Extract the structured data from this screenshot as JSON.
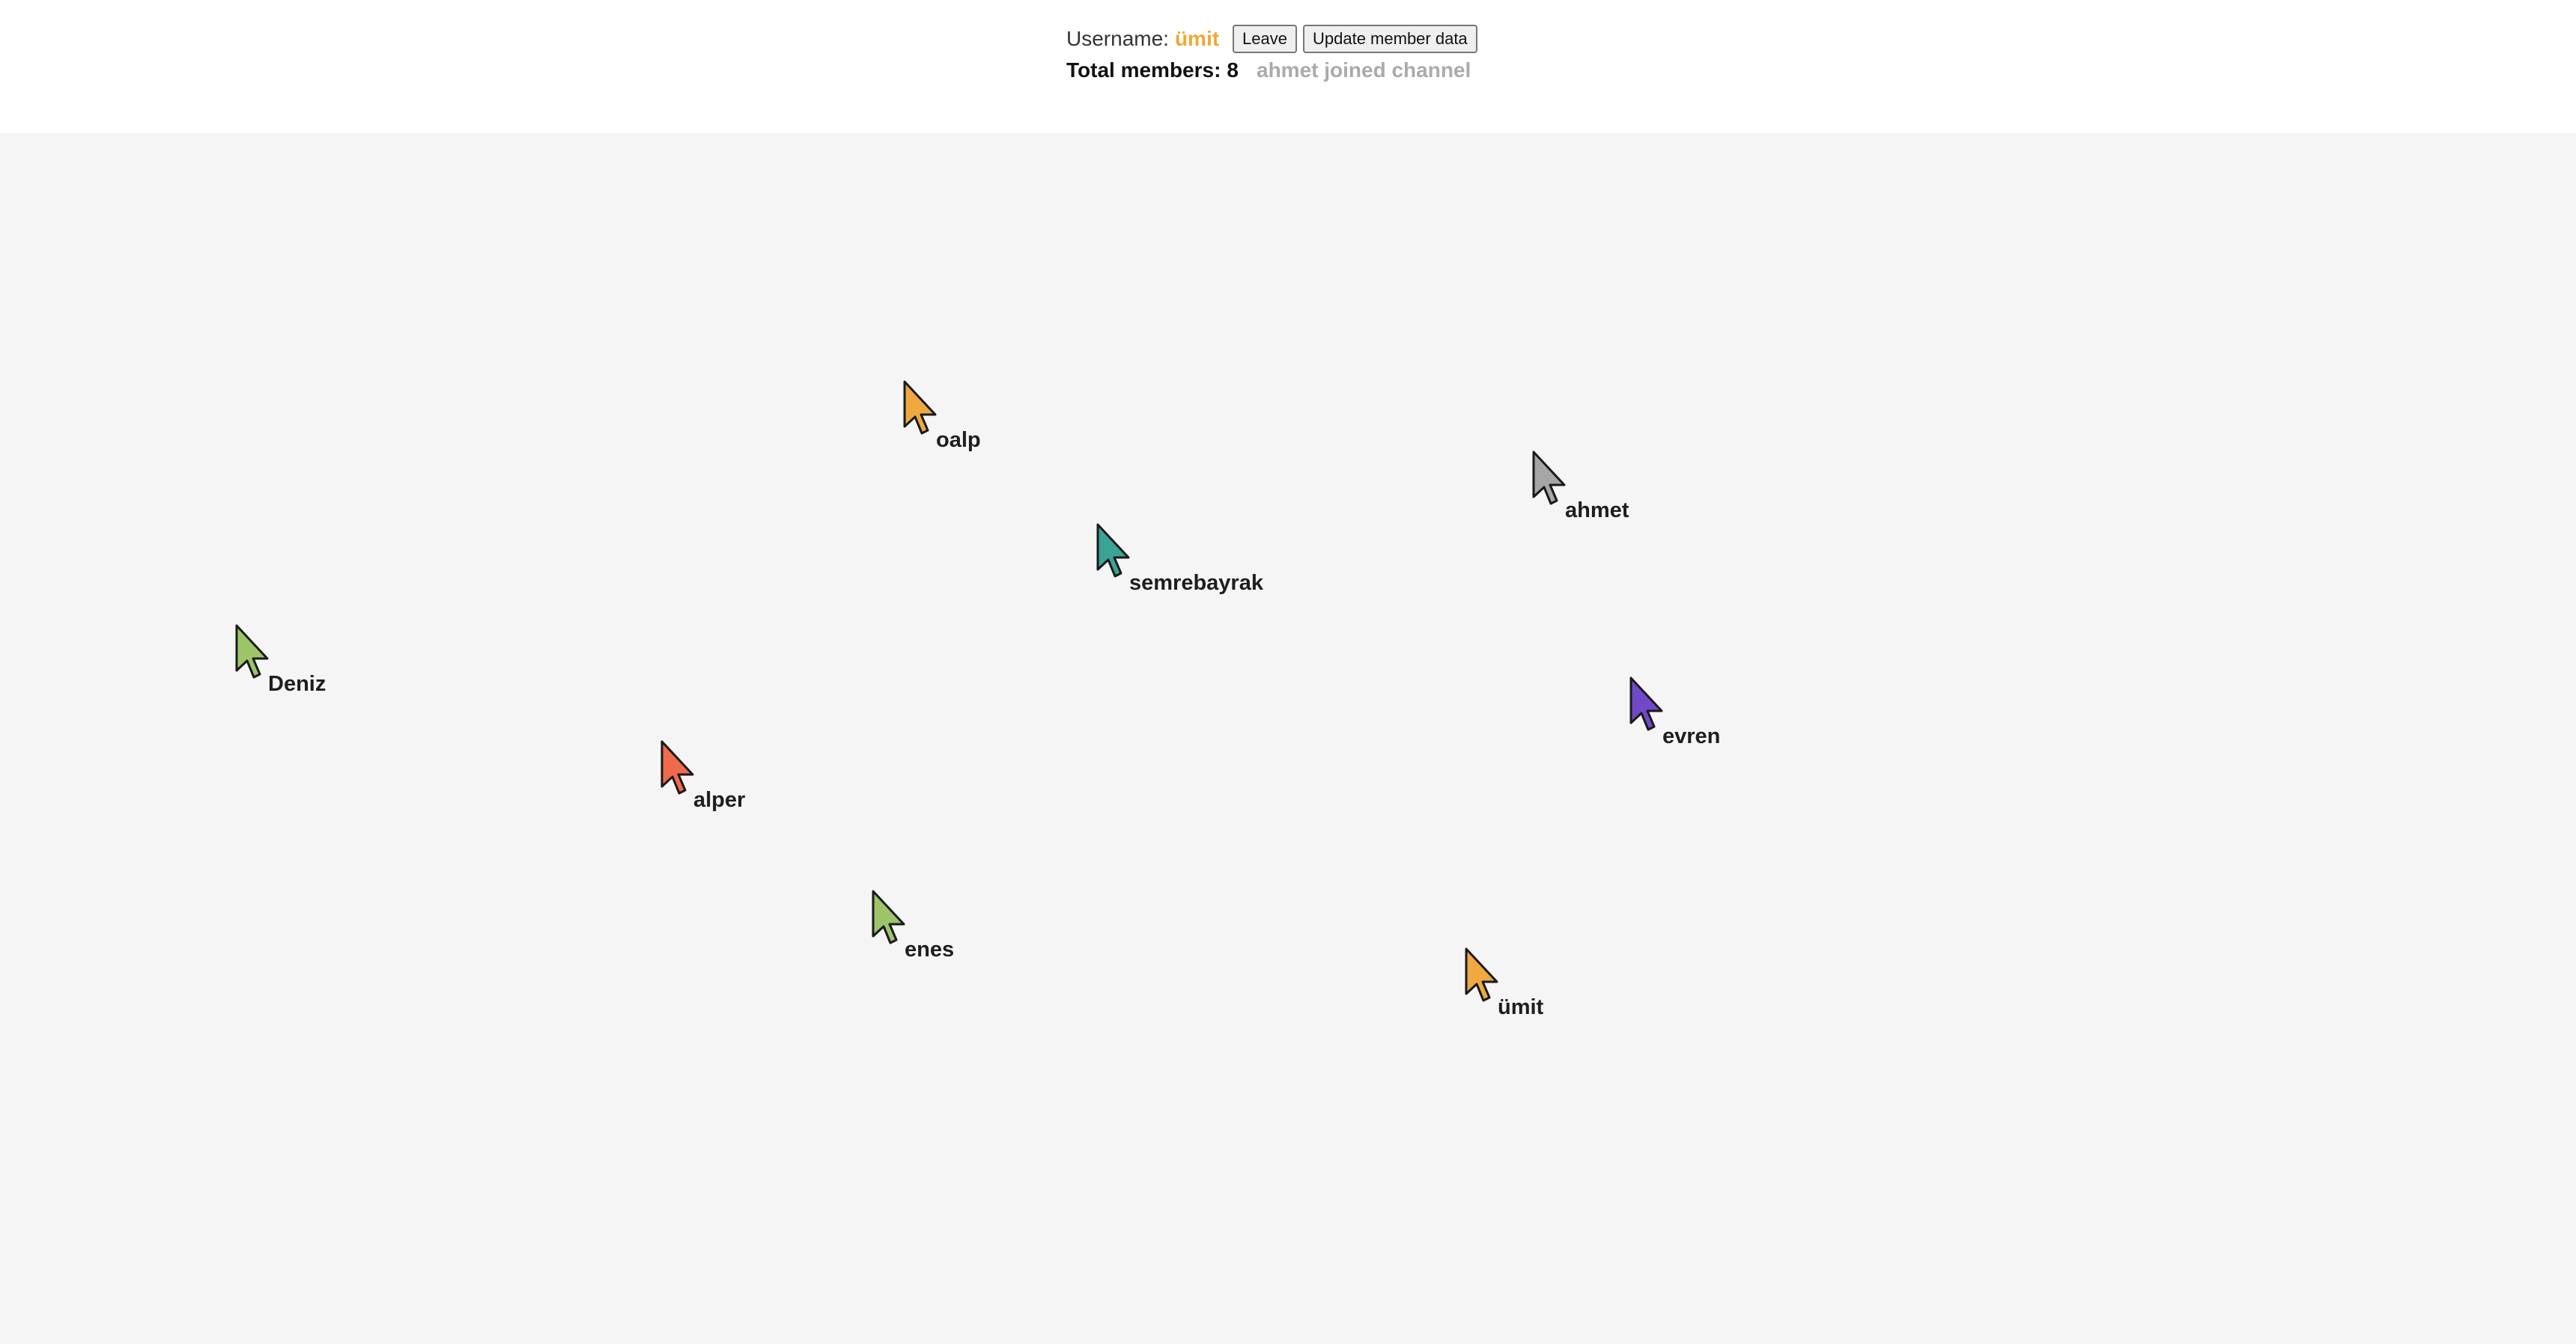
{
  "header": {
    "username_label": "Username:",
    "username_value": "ümit",
    "username_color": "#f0a830",
    "leave_label": "Leave",
    "update_label": "Update member data",
    "members_label": "Total members:",
    "members_count": "8",
    "activity_message": "ahmet joined channel"
  },
  "cursors": [
    {
      "name": "oalp",
      "color": "#f0a840",
      "icon": "mouse-pointer-icon"
    },
    {
      "name": "ahmet",
      "color": "#a6a6a6",
      "icon": "mouse-pointer-icon"
    },
    {
      "name": "semrebayrak",
      "color": "#3aa395",
      "icon": "mouse-pointer-icon"
    },
    {
      "name": "Deniz",
      "color": "#9cc56a",
      "icon": "mouse-pointer-icon"
    },
    {
      "name": "evren",
      "color": "#7148c8",
      "icon": "mouse-pointer-icon"
    },
    {
      "name": "alper",
      "color": "#f06b4b",
      "icon": "mouse-pointer-icon"
    },
    {
      "name": "enes",
      "color": "#9cc56a",
      "icon": "mouse-pointer-icon"
    },
    {
      "name": "ümit",
      "color": "#f0a840",
      "icon": "mouse-pointer-icon"
    }
  ]
}
